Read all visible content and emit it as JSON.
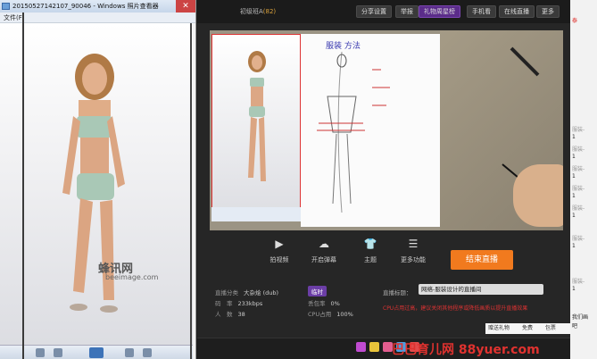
{
  "viewer": {
    "title": "20150527142107_90046 - Windows 照片查看器",
    "close": "✕",
    "menu": "文件(F)",
    "watermark": "蜂讯网",
    "watermark_sub": "beeimage.com"
  },
  "app": {
    "username": "初级班A",
    "username_tag": "(82)",
    "toolbar": [
      "分享设置",
      "举报",
      "礼物周星榜",
      "手机看",
      "在线直播",
      "更多"
    ],
    "hot_index": 2,
    "paper_heading": "服装 方法",
    "controls": [
      {
        "label": "拍视频",
        "icon": "▶"
      },
      {
        "label": "开启弹幕",
        "icon": "☁"
      },
      {
        "label": "主题",
        "icon": "👕"
      },
      {
        "label": "更多功能",
        "icon": "☰"
      }
    ],
    "end_button": "结束直播",
    "info": {
      "category_label": "直播分类",
      "category_value": "大杂烩 (dub)",
      "bitrate_label": "码　率",
      "bitrate_value": "233kbps",
      "count_label": "人　数",
      "count_value": "38",
      "cpu_label": "CPU占用",
      "cpu_value": "100%",
      "loss_label": "丢包率",
      "loss_value": "0%",
      "tag": "临时",
      "title_label": "直播标题：",
      "title_value": "网络-服装设计的直播间",
      "warning": "CPU占用过高，建议关闭其他程序或降低画质以提升直播效果"
    }
  },
  "brand": "巴巴育儿网 88yuer.com",
  "chat": {
    "header": "泰",
    "lines": [
      "服装-",
      "1",
      "服装-",
      "1",
      "服装-",
      "1",
      "服装-",
      "1",
      "服装-",
      "1",
      "服装-",
      "1",
      "服装-",
      "1",
      "我们画",
      "吧"
    ],
    "gift": "赠送礼物",
    "gift_action": "免费",
    "gift_extra": "包票"
  }
}
